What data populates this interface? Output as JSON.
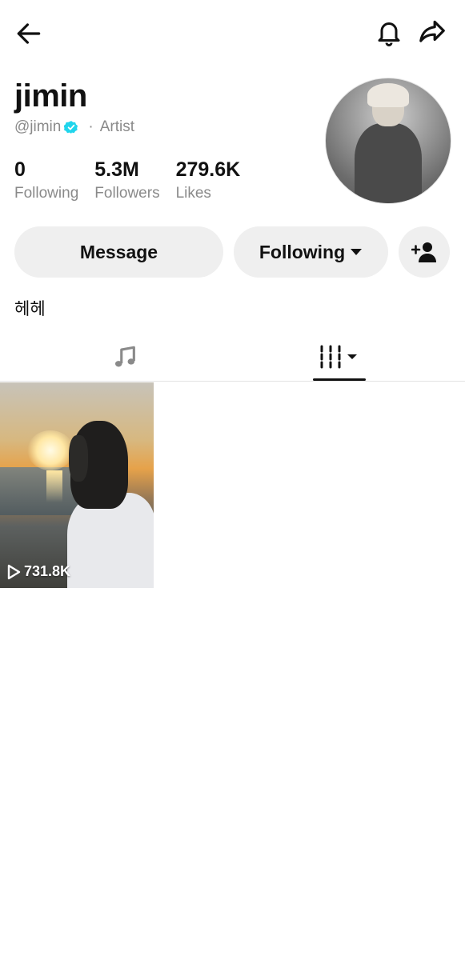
{
  "profile": {
    "name": "jimin",
    "handle": "@jimin",
    "role": "Artist",
    "separator": "·",
    "bio": "헤헤"
  },
  "stats": [
    {
      "value": "0",
      "label": "Following"
    },
    {
      "value": "5.3M",
      "label": "Followers"
    },
    {
      "value": "279.6K",
      "label": "Likes"
    }
  ],
  "actions": {
    "message_label": "Message",
    "following_label": "Following"
  },
  "videos": [
    {
      "views": "731.8K"
    }
  ],
  "colors": {
    "verified": "#20D5EC",
    "button_bg": "#EFEFEF",
    "muted_text": "#8A8A8A"
  },
  "icons": {
    "back": "arrow-left-icon",
    "notifications": "bell-icon",
    "share": "share-icon",
    "add_friend": "add-user-icon",
    "music_tab": "music-note-icon",
    "videos_tab": "grid-bars-icon"
  }
}
